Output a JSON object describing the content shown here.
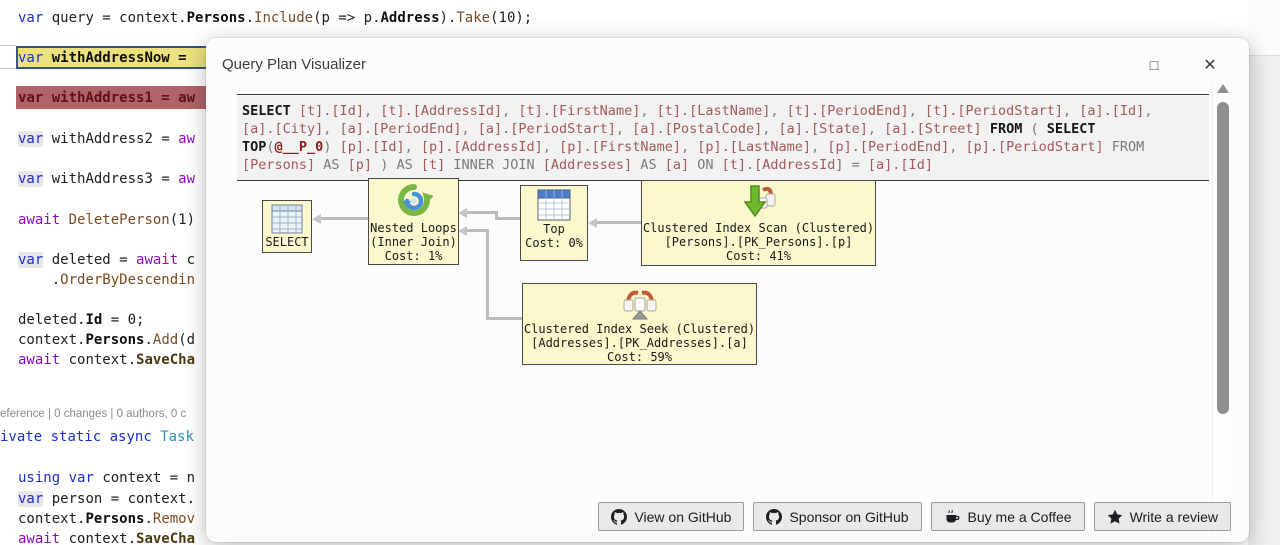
{
  "editor": {
    "codelens": "eference | 0 changes | 0 authors, 0 c",
    "lines": [
      {
        "segs": [
          {
            "t": "var",
            "c": "kw"
          },
          {
            "t": " query = context.",
            "c": "pl"
          },
          {
            "t": "Persons",
            "c": "bold"
          },
          {
            "t": ".",
            "c": "pl"
          },
          {
            "t": "Include",
            "c": "mth"
          },
          {
            "t": "(p => p.",
            "c": "pl"
          },
          {
            "t": "Address",
            "c": "bold"
          },
          {
            "t": ").",
            "c": "pl"
          },
          {
            "t": "Take",
            "c": "mth"
          },
          {
            "t": "(10);",
            "c": "pl"
          }
        ]
      },
      {
        "segs": [
          {
            "t": "var",
            "c": "kw"
          },
          {
            "t": " withAddressNow = ",
            "c": "bold"
          }
        ]
      },
      {
        "segs": [
          {
            "t": "var withAddress1 = aw",
            "c": "red"
          }
        ]
      },
      {
        "segs": [
          {
            "t": "var",
            "c": "kwhl"
          },
          {
            "t": " withAddress2 = ",
            "c": "pl"
          },
          {
            "t": "aw",
            "c": "ctrl"
          }
        ]
      },
      {
        "segs": [
          {
            "t": "var",
            "c": "kwhl"
          },
          {
            "t": " withAddress3 = ",
            "c": "pl"
          },
          {
            "t": "aw",
            "c": "ctrl"
          }
        ]
      },
      {
        "segs": [
          {
            "t": "await",
            "c": "ctrl"
          },
          {
            "t": " ",
            "c": "pl"
          },
          {
            "t": "DeletePerson",
            "c": "mth"
          },
          {
            "t": "(1)",
            "c": "pl"
          }
        ]
      },
      {
        "segs": [
          {
            "t": "var",
            "c": "kwhl"
          },
          {
            "t": " deleted = ",
            "c": "pl"
          },
          {
            "t": "await",
            "c": "ctrl"
          },
          {
            "t": " c",
            "c": "pl"
          }
        ]
      },
      {
        "segs": [
          {
            "t": "    .",
            "c": "pl"
          },
          {
            "t": "OrderByDescendin",
            "c": "mth"
          }
        ]
      },
      {
        "segs": [
          {
            "t": "deleted.",
            "c": "pl"
          },
          {
            "t": "Id",
            "c": "bold"
          },
          {
            "t": " = 0;",
            "c": "pl"
          }
        ]
      },
      {
        "segs": [
          {
            "t": "context.",
            "c": "pl"
          },
          {
            "t": "Persons",
            "c": "bold"
          },
          {
            "t": ".",
            "c": "pl"
          },
          {
            "t": "Add",
            "c": "mth"
          },
          {
            "t": "(d",
            "c": "pl"
          }
        ]
      },
      {
        "segs": [
          {
            "t": "await",
            "c": "ctrl"
          },
          {
            "t": " context.",
            "c": "pl"
          },
          {
            "t": "SaveCha",
            "c": "boldmth"
          }
        ]
      },
      {
        "segs": [
          {
            "t": "ivate",
            "c": "kw"
          },
          {
            "t": " ",
            "c": "pl"
          },
          {
            "t": "static",
            "c": "kw"
          },
          {
            "t": " ",
            "c": "pl"
          },
          {
            "t": "async",
            "c": "kw"
          },
          {
            "t": " ",
            "c": "pl"
          },
          {
            "t": "Task",
            "c": "type"
          }
        ]
      },
      {
        "segs": [
          {
            "t": "using",
            "c": "kw"
          },
          {
            "t": " ",
            "c": "pl"
          },
          {
            "t": "var",
            "c": "kw"
          },
          {
            "t": " context = n",
            "c": "pl"
          }
        ]
      },
      {
        "segs": [
          {
            "t": "var",
            "c": "kwhl"
          },
          {
            "t": " person = context.",
            "c": "pl"
          }
        ]
      },
      {
        "segs": [
          {
            "t": "context.",
            "c": "pl"
          },
          {
            "t": "Persons",
            "c": "bold"
          },
          {
            "t": ".",
            "c": "pl"
          },
          {
            "t": "Remov",
            "c": "mth"
          }
        ]
      },
      {
        "segs": [
          {
            "t": "await",
            "c": "ctrl"
          },
          {
            "t": " context.",
            "c": "pl"
          },
          {
            "t": "SaveCha",
            "c": "boldmth"
          }
        ]
      }
    ]
  },
  "dialog": {
    "title": "Query Plan Visualizer",
    "window": {
      "maximize": "□",
      "close": "✕"
    },
    "sql": {
      "lines": [
        [
          {
            "t": "SELECT",
            "c": "skw"
          },
          {
            "t": " ",
            "c": "spun"
          },
          {
            "t": "[t].[Id]",
            "c": "sid"
          },
          {
            "t": ", ",
            "c": "spun"
          },
          {
            "t": "[t].[AddressId]",
            "c": "sid"
          },
          {
            "t": ", ",
            "c": "spun"
          },
          {
            "t": "[t].[FirstName]",
            "c": "sid"
          },
          {
            "t": ", ",
            "c": "spun"
          },
          {
            "t": "[t].[LastName]",
            "c": "sid"
          },
          {
            "t": ", ",
            "c": "spun"
          },
          {
            "t": "[t].[PeriodEnd]",
            "c": "sid"
          },
          {
            "t": ", ",
            "c": "spun"
          },
          {
            "t": "[t].[PeriodStart]",
            "c": "sid"
          },
          {
            "t": ", ",
            "c": "spun"
          },
          {
            "t": "[a].[Id]",
            "c": "sid"
          },
          {
            "t": ",",
            "c": "spun"
          }
        ],
        [
          {
            "t": "[a].[City]",
            "c": "sid"
          },
          {
            "t": ", ",
            "c": "spun"
          },
          {
            "t": "[a].[PeriodEnd]",
            "c": "sid"
          },
          {
            "t": ", ",
            "c": "spun"
          },
          {
            "t": "[a].[PeriodStart]",
            "c": "sid"
          },
          {
            "t": ", ",
            "c": "spun"
          },
          {
            "t": "[a].[PostalCode]",
            "c": "sid"
          },
          {
            "t": ", ",
            "c": "spun"
          },
          {
            "t": "[a].[State]",
            "c": "sid"
          },
          {
            "t": ", ",
            "c": "spun"
          },
          {
            "t": "[a].[Street]",
            "c": "sid"
          },
          {
            "t": " ",
            "c": "spun"
          },
          {
            "t": "FROM",
            "c": "skw"
          },
          {
            "t": " ( ",
            "c": "spun"
          },
          {
            "t": "SELECT",
            "c": "skw"
          }
        ],
        [
          {
            "t": "TOP",
            "c": "skw"
          },
          {
            "t": "(",
            "c": "spun"
          },
          {
            "t": "@__P_0",
            "c": "sparam"
          },
          {
            "t": ") ",
            "c": "spun"
          },
          {
            "t": "[p].[Id]",
            "c": "sid"
          },
          {
            "t": ", ",
            "c": "spun"
          },
          {
            "t": "[p].[AddressId]",
            "c": "sid"
          },
          {
            "t": ", ",
            "c": "spun"
          },
          {
            "t": "[p].[FirstName]",
            "c": "sid"
          },
          {
            "t": ", ",
            "c": "spun"
          },
          {
            "t": "[p].[LastName]",
            "c": "sid"
          },
          {
            "t": ", ",
            "c": "spun"
          },
          {
            "t": "[p].[PeriodEnd]",
            "c": "sid"
          },
          {
            "t": ", ",
            "c": "spun"
          },
          {
            "t": "[p].[PeriodStart]",
            "c": "sid"
          },
          {
            "t": " FROM",
            "c": "spun"
          }
        ],
        [
          {
            "t": "[Persons]",
            "c": "sid"
          },
          {
            "t": " AS ",
            "c": "spun"
          },
          {
            "t": "[p]",
            "c": "sid"
          },
          {
            "t": " ) AS ",
            "c": "spun"
          },
          {
            "t": "[t]",
            "c": "sid"
          },
          {
            "t": " INNER JOIN ",
            "c": "spun"
          },
          {
            "t": "[Addresses]",
            "c": "sid"
          },
          {
            "t": " AS ",
            "c": "spun"
          },
          {
            "t": "[a]",
            "c": "sid"
          },
          {
            "t": " ON ",
            "c": "spun"
          },
          {
            "t": "[t].[AddressId]",
            "c": "sid"
          },
          {
            "t": " = ",
            "c": "spun"
          },
          {
            "t": "[a].[Id]",
            "c": "sid"
          }
        ]
      ]
    },
    "plan": {
      "select": {
        "label": "SELECT"
      },
      "nested": {
        "l1": "Nested Loops",
        "l2": "(Inner Join)",
        "l3": "Cost: 1%"
      },
      "top": {
        "l1": "Top",
        "l2": "Cost: 0%"
      },
      "scan": {
        "l1": "Clustered Index Scan (Clustered)",
        "l2": "[Persons].[PK_Persons].[p]",
        "l3": "Cost: 41%"
      },
      "seek": {
        "l1": "Clustered Index Seek (Clustered)",
        "l2": "[Addresses].[PK_Addresses].[a]",
        "l3": "Cost: 59%"
      }
    },
    "footer": {
      "buttons": [
        {
          "label": "View on GitHub"
        },
        {
          "label": "Sponsor on GitHub"
        },
        {
          "label": "Buy me a Coffee"
        },
        {
          "label": "Write a review"
        }
      ]
    }
  }
}
